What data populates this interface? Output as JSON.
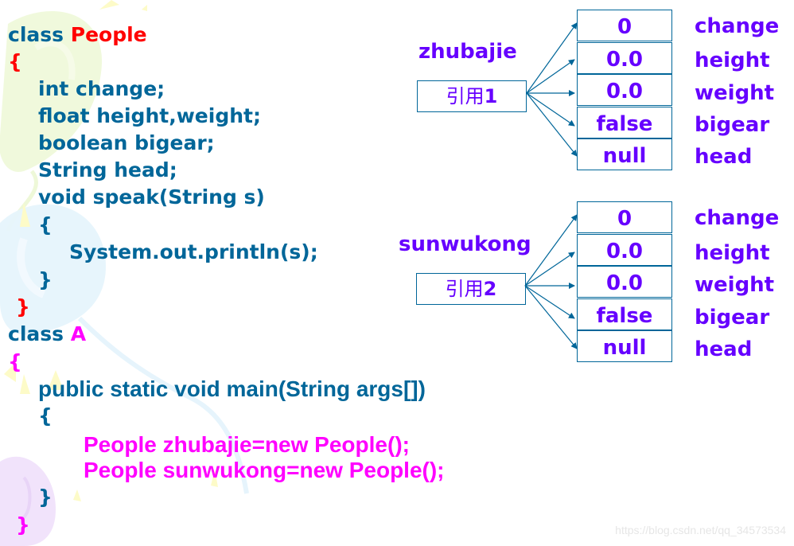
{
  "code": {
    "class1_keyword": "class",
    "class1_name": "People",
    "open_brace": "{",
    "close_brace": "}",
    "fields": [
      "int change;",
      "float height,weight;",
      "boolean bigear;",
      "String head;"
    ],
    "method_sig": "void speak(String s)",
    "method_body": "System.out.println(s);",
    "class2_keyword": "class",
    "class2_name": "A",
    "main_sig": "public static void main(String args[])",
    "main_body": [
      "People zhubajie=new People();",
      "People sunwukong=new People();"
    ]
  },
  "objects": [
    {
      "var_name": "zhubajie",
      "ref_label": "引用",
      "ref_num": "1",
      "cells": [
        "0",
        "0.0",
        "0.0",
        "false",
        "null"
      ],
      "fields": [
        "change",
        "height",
        "weight",
        "bigear",
        "head"
      ]
    },
    {
      "var_name": "sunwukong",
      "ref_label": "引用",
      "ref_num": "2",
      "cells": [
        "0",
        "0.0",
        "0.0",
        "false",
        "null"
      ],
      "fields": [
        "change",
        "height",
        "weight",
        "bigear",
        "head"
      ]
    }
  ],
  "colors": {
    "code_blue": "#006699",
    "class_red": "#ff0000",
    "main_magenta": "#ff00ff",
    "diagram_purple": "#6600ff",
    "arrow": "#006699"
  },
  "watermark": "https://blog.csdn.net/qq_34573534"
}
